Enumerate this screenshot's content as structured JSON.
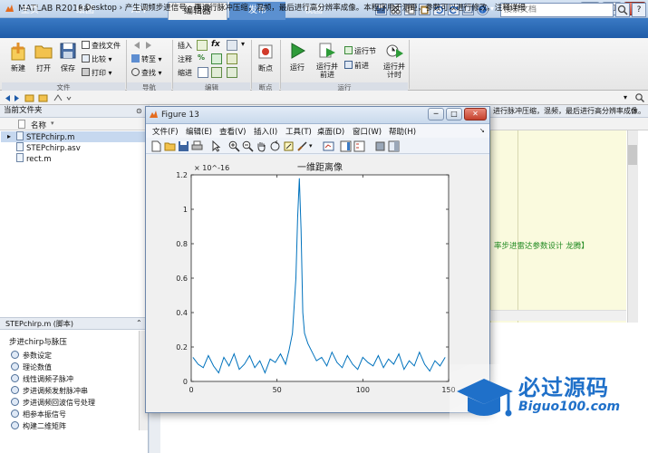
{
  "window": {
    "title": "MATLAB R2018a",
    "controls": {
      "minimize": "─",
      "maximize": "□",
      "close": "✕"
    }
  },
  "tabs": [
    {
      "label": "主页"
    },
    {
      "label": "绘图"
    },
    {
      "label": "APP"
    },
    {
      "label": "编辑器"
    },
    {
      "label": "发布"
    },
    {
      "label": "视图"
    }
  ],
  "active_tab_color": "#f0f0f0",
  "search": {
    "placeholder": "搜索文档",
    "help": "?"
  },
  "quick_access_dropdown": "▾",
  "ribbon": {
    "file_group": {
      "label": "文件",
      "new": "新建",
      "open": "打开",
      "save": "保存",
      "find_files": "查找文件",
      "compare": "比较",
      "print": "打印"
    },
    "nav_group": {
      "label": "导航",
      "goto": "转至",
      "find": "查找"
    },
    "edit_group": {
      "label": "编辑",
      "insert": "插入",
      "comment": "注释",
      "indent": "缩进",
      "fx": "fx",
      "percent": "%"
    },
    "breakpoint_group": {
      "label": "断点",
      "breakpoints": "断点"
    },
    "run_group": {
      "label": "运行",
      "run": "运行",
      "run_advance": "运行并\n前进",
      "run_section": "运行节",
      "advance": "前进",
      "run_time": "运行并\n计时"
    }
  },
  "address": {
    "path": "« Desktop › 产生调频步进信号，再进行脉冲压缩，混频，最后进行高分辨率成像。本程序用于测距，参数可以进行修改。注释详细"
  },
  "current_folder": {
    "title": "当前文件夹",
    "column": "名称",
    "sort_indicator": "▾",
    "files": [
      {
        "name": "STEPchirp.m",
        "selected": true
      },
      {
        "name": "STEPchirp.asv",
        "selected": false
      },
      {
        "name": "rect.m",
        "selected": false
      }
    ]
  },
  "details": {
    "header": "STEPchirp.m  (脚本)",
    "title": "步进chirp与脉压",
    "sections": [
      "参数设定",
      "理论数值",
      "线性调频子脉冲",
      "步进调频发射脉冲串",
      "步进调频回波信号处理",
      "相参本振信号",
      "构建二维矩阵"
    ]
  },
  "editor": {
    "title_clip": "进行脉冲压缩，混频，最后进行高分辨率成像。",
    "comment_text": "率步进雷达参数设计 龙腾】"
  },
  "figure": {
    "title": "Figure 13",
    "controls": {
      "minimize": "─",
      "maximize": "□",
      "close": "✕"
    },
    "menus": [
      "文件(F)",
      "编辑(E)",
      "查看(V)",
      "插入(I)",
      "工具(T)",
      "桌面(D)",
      "窗口(W)",
      "帮助(H)"
    ]
  },
  "chart_data": {
    "type": "line",
    "title": "一维距离像",
    "xlabel": "",
    "ylabel": "",
    "y_exponent_label": "× 10^-16",
    "xlim": [
      0,
      150
    ],
    "ylim": [
      0,
      1.2e-16
    ],
    "x_ticks": [
      "0",
      "50",
      "100",
      "150"
    ],
    "y_ticks": [
      "0",
      "0.2",
      "0.4",
      "0.6",
      "0.8",
      "1",
      "1.2"
    ],
    "grid": false,
    "line_color": "#0072bd",
    "series": [
      {
        "x": [
          1,
          4,
          7,
          10,
          13,
          16,
          19,
          22,
          25,
          28,
          31,
          34,
          37,
          40,
          43,
          46,
          49,
          52,
          55,
          57,
          59,
          61,
          62,
          63,
          64,
          65,
          66,
          68,
          70,
          73,
          76,
          79,
          82,
          85,
          88,
          91,
          94,
          97,
          100,
          103,
          106,
          109,
          112,
          115,
          118,
          121,
          124,
          127,
          130,
          133,
          136,
          139,
          142,
          145,
          148
        ],
        "y": [
          1.4e-17,
          1e-17,
          8e-18,
          1.5e-17,
          9e-18,
          5e-18,
          1.4e-17,
          9e-18,
          1.6e-17,
          7e-18,
          1e-17,
          1.5e-17,
          8e-18,
          1.2e-17,
          5e-18,
          1.3e-17,
          1.1e-17,
          1.6e-17,
          1e-17,
          1.8e-17,
          2.8e-17,
          6e-17,
          9.5e-17,
          1.18e-16,
          8.8e-17,
          4e-17,
          2.8e-17,
          2.2e-17,
          1.8e-17,
          1.2e-17,
          1.4e-17,
          9e-18,
          1.7e-17,
          1.1e-17,
          8e-18,
          1.5e-17,
          1e-17,
          7e-18,
          1.4e-17,
          1.1e-17,
          9e-18,
          1.5e-17,
          8e-18,
          1.3e-17,
          1e-17,
          1.6e-17,
          7e-18,
          1.2e-17,
          9e-18,
          1.7e-17,
          1e-17,
          6e-18,
          1.2e-17,
          9e-18,
          1.4e-17
        ]
      }
    ]
  },
  "watermark": {
    "text": "必过源码",
    "url": "Biguo100.com"
  }
}
